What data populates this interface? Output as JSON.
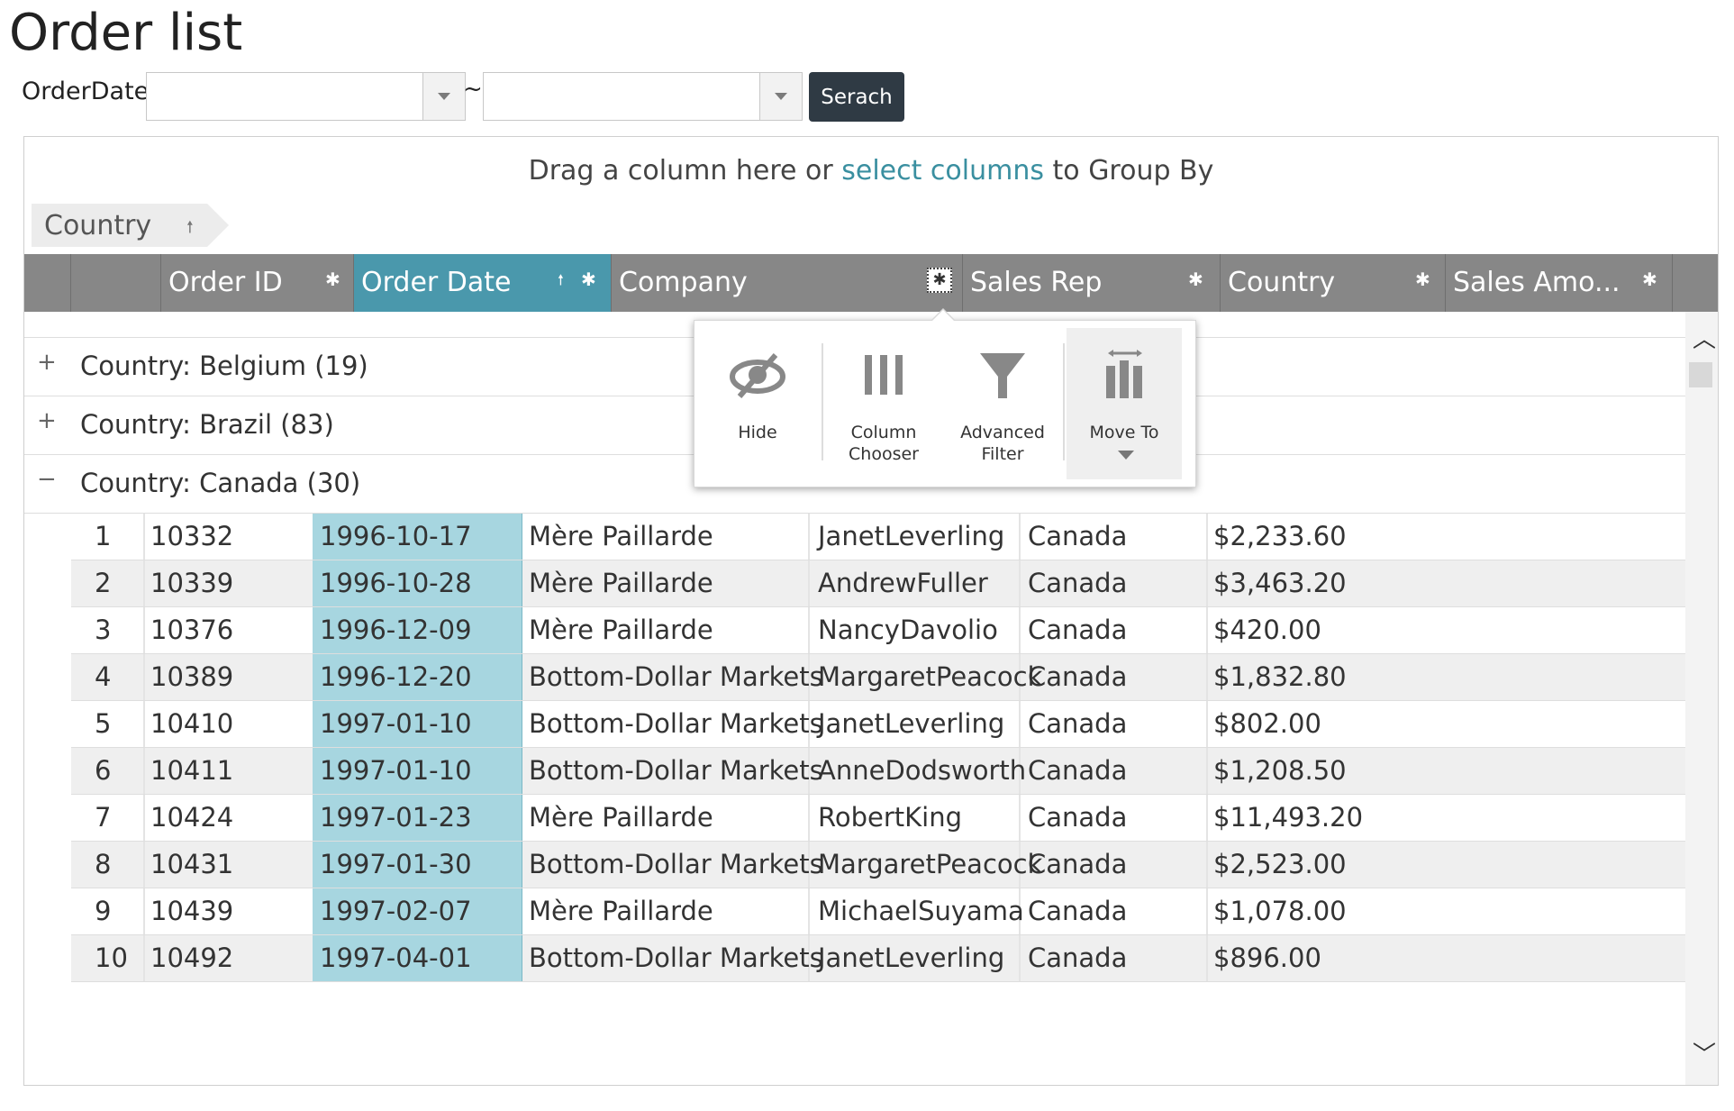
{
  "page": {
    "title": "Order list"
  },
  "filter": {
    "label": "OrderDate:",
    "from_value": "",
    "to_value": "",
    "separator": "~",
    "search_label": "Serach"
  },
  "grid": {
    "group_hint_prefix": "Drag a column here or ",
    "group_hint_link": "select columns",
    "group_hint_suffix": " to Group By",
    "group_chip": "Country",
    "columns": [
      "Order ID",
      "Order Date",
      "Company",
      "Sales Rep",
      "Country",
      "Sales Amo..."
    ],
    "groups": [
      {
        "label": "Country: Belgium (19)",
        "expander": "+"
      },
      {
        "label": "Country: Brazil (83)",
        "expander": "+"
      },
      {
        "label": "Country: Canada (30)",
        "expander": "−"
      }
    ],
    "rows": [
      [
        "1",
        "10332",
        "1996-10-17",
        "Mère Paillarde",
        "JanetLeverling",
        "Canada",
        "$2,233.60"
      ],
      [
        "2",
        "10339",
        "1996-10-28",
        "Mère Paillarde",
        "AndrewFuller",
        "Canada",
        "$3,463.20"
      ],
      [
        "3",
        "10376",
        "1996-12-09",
        "Mère Paillarde",
        "NancyDavolio",
        "Canada",
        "$420.00"
      ],
      [
        "4",
        "10389",
        "1996-12-20",
        "Bottom-Dollar Markets",
        "MargaretPeacock",
        "Canada",
        "$1,832.80"
      ],
      [
        "5",
        "10410",
        "1997-01-10",
        "Bottom-Dollar Markets",
        "JanetLeverling",
        "Canada",
        "$802.00"
      ],
      [
        "6",
        "10411",
        "1997-01-10",
        "Bottom-Dollar Markets",
        "AnneDodsworth",
        "Canada",
        "$1,208.50"
      ],
      [
        "7",
        "10424",
        "1997-01-23",
        "Mère Paillarde",
        "RobertKing",
        "Canada",
        "$11,493.20"
      ],
      [
        "8",
        "10431",
        "1997-01-30",
        "Bottom-Dollar Markets",
        "MargaretPeacock",
        "Canada",
        "$2,523.00"
      ],
      [
        "9",
        "10439",
        "1997-02-07",
        "Mère Paillarde",
        "MichaelSuyama",
        "Canada",
        "$1,078.00"
      ],
      [
        "10",
        "10492",
        "1997-04-01",
        "Bottom-Dollar Markets",
        "JanetLeverling",
        "Canada",
        "$896.00"
      ]
    ]
  },
  "column_menu": {
    "hide": "Hide",
    "column_chooser_l1": "Column",
    "column_chooser_l2": "Chooser",
    "advanced_filter_l1": "Advanced",
    "advanced_filter_l2": "Filter",
    "move_to": "Move To"
  },
  "colors": {
    "accent": "#4a98ac",
    "header_bg": "#878787",
    "selected_col_bg": "#a7d6e0",
    "button_dark": "#2f3a44",
    "link": "#3a8fa0"
  },
  "icons": [
    "gear-icon",
    "sort-ascending-icon",
    "hide-eye-icon",
    "column-chooser-icon",
    "filter-funnel-icon",
    "move-to-icon",
    "chevron-up-icon",
    "chevron-down-icon",
    "dropdown-caret-icon"
  ]
}
